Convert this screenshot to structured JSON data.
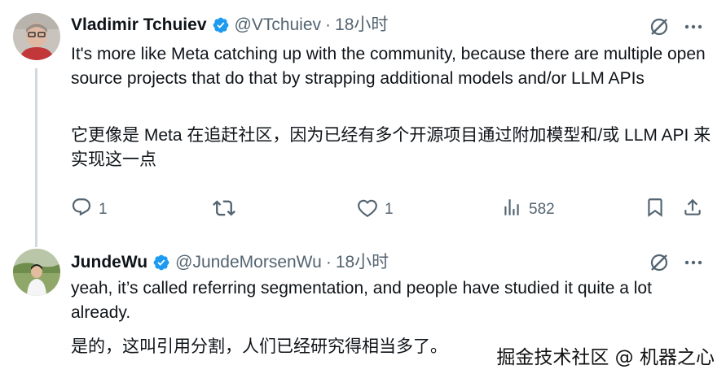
{
  "tweets": [
    {
      "name": "Vladimir Tchuiev",
      "handle": "@VTchuiev",
      "separator": "·",
      "time": "18小时",
      "text_en": "It's more like Meta catching up with the community, because there are multiple open source projects that do that by strapping additional models and/or LLM APIs",
      "text_zh": "它更像是 Meta 在追赶社区，因为已经有多个开源项目通过附加模型和/或 LLM API 来实现这一点",
      "replies": "1",
      "retweets": "",
      "likes": "1",
      "views": "582"
    },
    {
      "name": "JundeWu",
      "handle": "@JundeMorsenWu",
      "separator": "·",
      "time": "18小时",
      "text_en": "yeah, it’s called referring segmentation, and people have studied it quite a lot already.",
      "text_zh": "是的，这叫引用分割，人们已经研究得相当多了。"
    }
  ],
  "watermark": "掘金技术社区 @ 机器之心",
  "colors": {
    "text": "#0f1419",
    "secondary": "#536471",
    "verified": "#1d9bf0",
    "thread_line": "#cfd9de"
  },
  "icons": [
    "verified-badge-icon",
    "grok-icon",
    "more-icon",
    "reply-icon",
    "retweet-icon",
    "like-icon",
    "views-icon",
    "bookmark-icon",
    "share-icon"
  ]
}
